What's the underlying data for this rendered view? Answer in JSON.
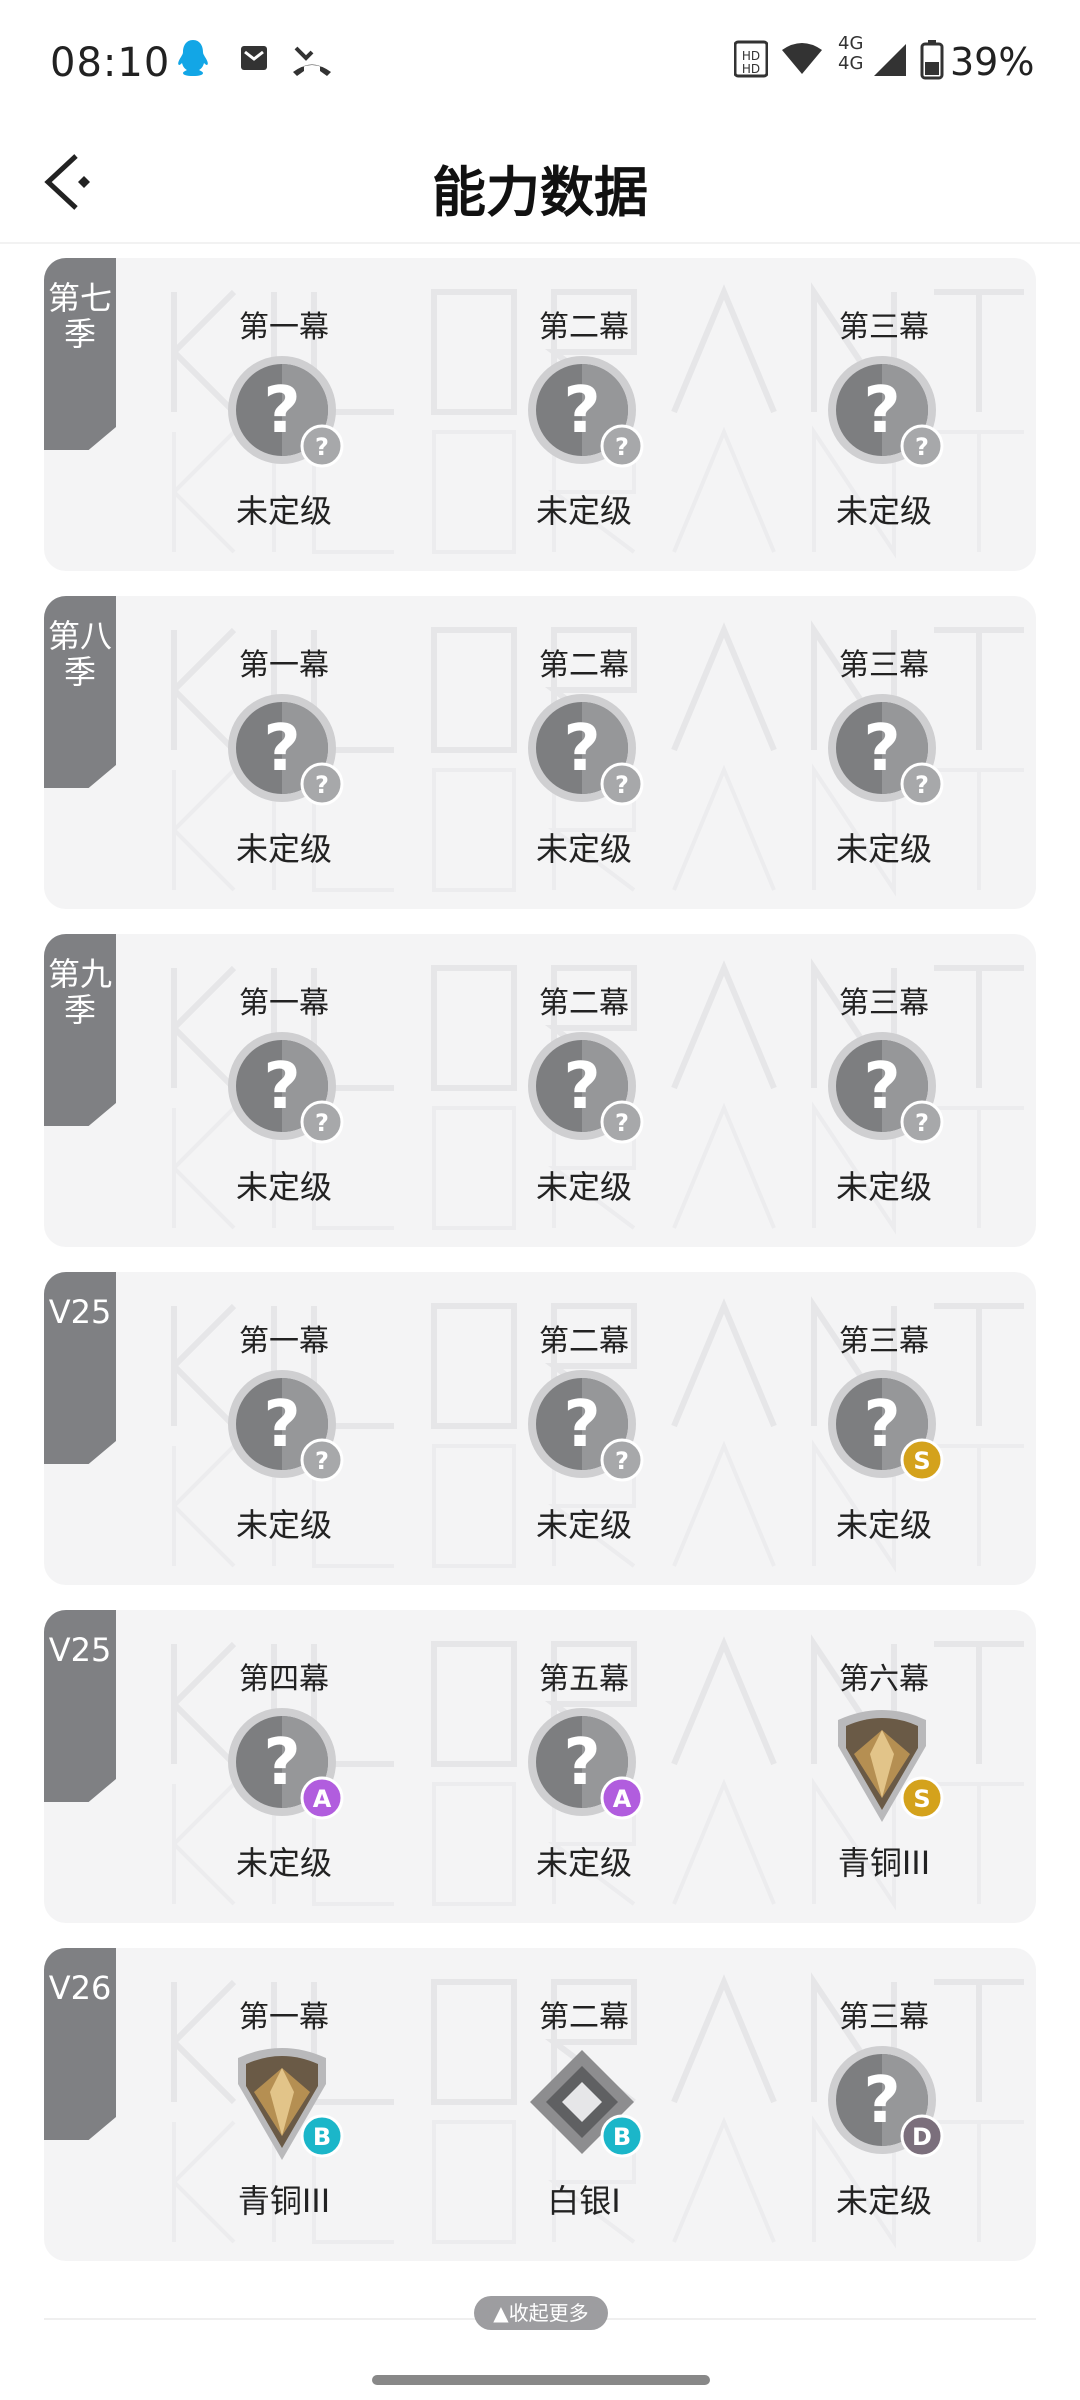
{
  "status_bar": {
    "time": "08:10",
    "network_label": "4G",
    "battery": "39%"
  },
  "header": {
    "title": "能力数据"
  },
  "cards": [
    {
      "tag": "第七季",
      "slots": [
        {
          "title": "第一幕",
          "rank": "未定级",
          "emblem": "unranked",
          "badge": "?"
        },
        {
          "title": "第二幕",
          "rank": "未定级",
          "emblem": "unranked",
          "badge": "?"
        },
        {
          "title": "第三幕",
          "rank": "未定级",
          "emblem": "unranked",
          "badge": "?"
        }
      ]
    },
    {
      "tag": "第八季",
      "slots": [
        {
          "title": "第一幕",
          "rank": "未定级",
          "emblem": "unranked",
          "badge": "?"
        },
        {
          "title": "第二幕",
          "rank": "未定级",
          "emblem": "unranked",
          "badge": "?"
        },
        {
          "title": "第三幕",
          "rank": "未定级",
          "emblem": "unranked",
          "badge": "?"
        }
      ]
    },
    {
      "tag": "第九季",
      "slots": [
        {
          "title": "第一幕",
          "rank": "未定级",
          "emblem": "unranked",
          "badge": "?"
        },
        {
          "title": "第二幕",
          "rank": "未定级",
          "emblem": "unranked",
          "badge": "?"
        },
        {
          "title": "第三幕",
          "rank": "未定级",
          "emblem": "unranked",
          "badge": "?"
        }
      ]
    },
    {
      "tag": "V25",
      "slots": [
        {
          "title": "第一幕",
          "rank": "未定级",
          "emblem": "unranked",
          "badge": "?"
        },
        {
          "title": "第二幕",
          "rank": "未定级",
          "emblem": "unranked",
          "badge": "?"
        },
        {
          "title": "第三幕",
          "rank": "未定级",
          "emblem": "unranked",
          "badge": "S"
        }
      ]
    },
    {
      "tag": "V25",
      "slots": [
        {
          "title": "第四幕",
          "rank": "未定级",
          "emblem": "unranked",
          "badge": "A"
        },
        {
          "title": "第五幕",
          "rank": "未定级",
          "emblem": "unranked",
          "badge": "A"
        },
        {
          "title": "第六幕",
          "rank": "青铜III",
          "emblem": "bronze",
          "badge": "S"
        }
      ]
    },
    {
      "tag": "V26",
      "slots": [
        {
          "title": "第一幕",
          "rank": "青铜III",
          "emblem": "bronze",
          "badge": "B"
        },
        {
          "title": "第二幕",
          "rank": "白银I",
          "emblem": "silver",
          "badge": "B"
        },
        {
          "title": "第三幕",
          "rank": "未定级",
          "emblem": "unranked",
          "badge": "D"
        }
      ]
    }
  ],
  "footer": {
    "collapse_label": "收起更多",
    "collapse_icon": "triangle-up-icon"
  },
  "colors": {
    "badge_unknown": "#a7a8aa",
    "badge_S": "#d4a21c",
    "badge_A": "#b15dde",
    "badge_B": "#1bb6c9",
    "badge_D": "#7b6f7c",
    "tag_bg": "#7f8083",
    "card_bg": "#f4f4f5"
  }
}
